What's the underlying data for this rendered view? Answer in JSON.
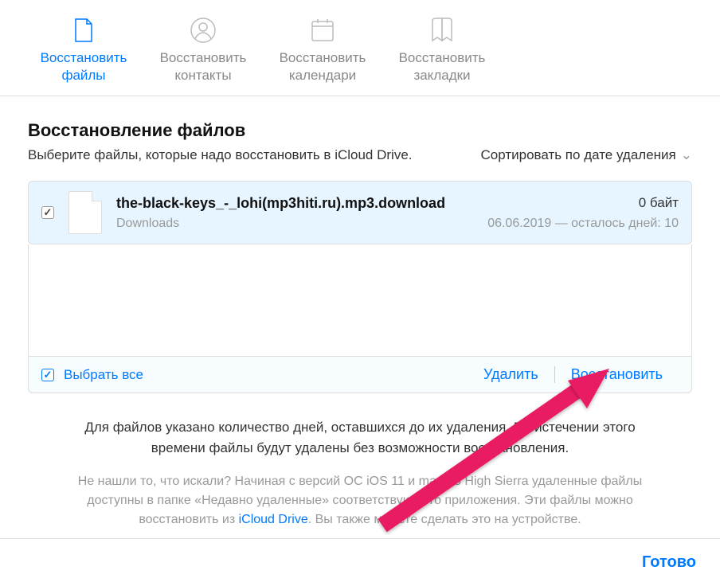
{
  "tabs": [
    {
      "line1": "Восстановить",
      "line2": "файлы"
    },
    {
      "line1": "Восстановить",
      "line2": "контакты"
    },
    {
      "line1": "Восстановить",
      "line2": "календари"
    },
    {
      "line1": "Восстановить",
      "line2": "закладки"
    }
  ],
  "header": {
    "title": "Восстановление файлов",
    "subtitle": "Выберите файлы, которые надо восстановить в iCloud Drive.",
    "sort_label": "Сортировать по дате удаления"
  },
  "file": {
    "name": "the-black-keys_-_lohi(mp3hiti.ru).mp3.download",
    "size": "0 байт",
    "location": "Downloads",
    "expiry": "06.06.2019 — осталось дней: 10"
  },
  "actions": {
    "select_all": "Выбрать все",
    "delete": "Удалить",
    "restore": "Восстановить"
  },
  "info": {
    "primary": "Для файлов указано количество дней, оставшихся до их удаления. По истечении этого времени файлы будут удалены без возможности восстановления.",
    "secondary_before": "Не нашли то, что искали? Начиная с версий ОС iOS 11 и macOS High Sierra удаленные файлы доступны в папке «Недавно удаленные» соответствующего приложения. Эти файлы можно восстановить из ",
    "secondary_link": "iCloud Drive",
    "secondary_after": ". Вы также можете сделать это на устройстве."
  },
  "footer": {
    "done": "Готово"
  }
}
